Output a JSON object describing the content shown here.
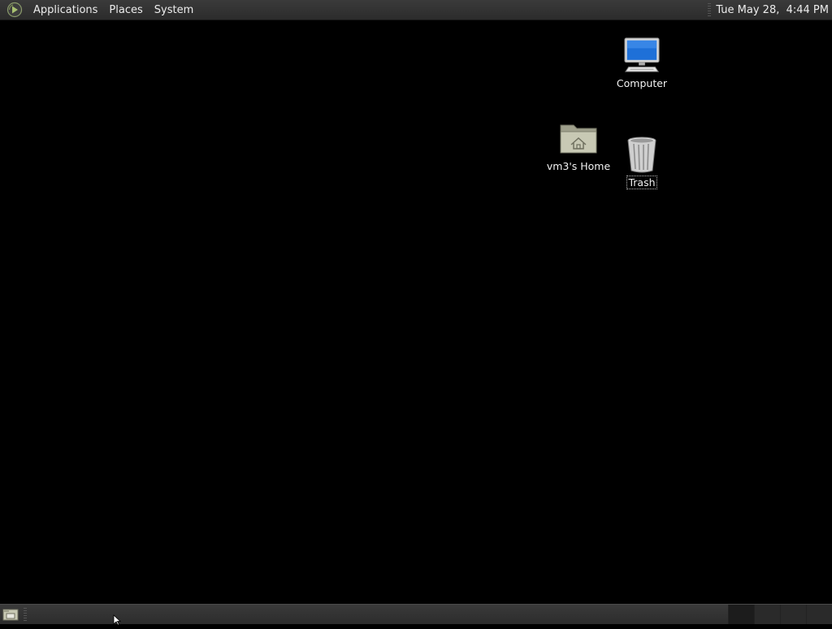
{
  "top_panel": {
    "menus": [
      "Applications",
      "Places",
      "System"
    ],
    "clock": "Tue May 28,  4:44 PM"
  },
  "desktop": {
    "icons": [
      {
        "label": "Computer",
        "icon": "computer-icon"
      },
      {
        "label": "vm3's Home",
        "icon": "home-folder-icon"
      },
      {
        "label": "Trash",
        "icon": "trash-icon"
      }
    ]
  },
  "bottom_panel": {
    "show_desktop_icon": "show-desktop-icon",
    "workspaces": 4,
    "active_workspace": 1
  },
  "colors": {
    "panel": "#2c2c2c",
    "desktop_background": "#000000",
    "panel_text": "#ececec"
  }
}
